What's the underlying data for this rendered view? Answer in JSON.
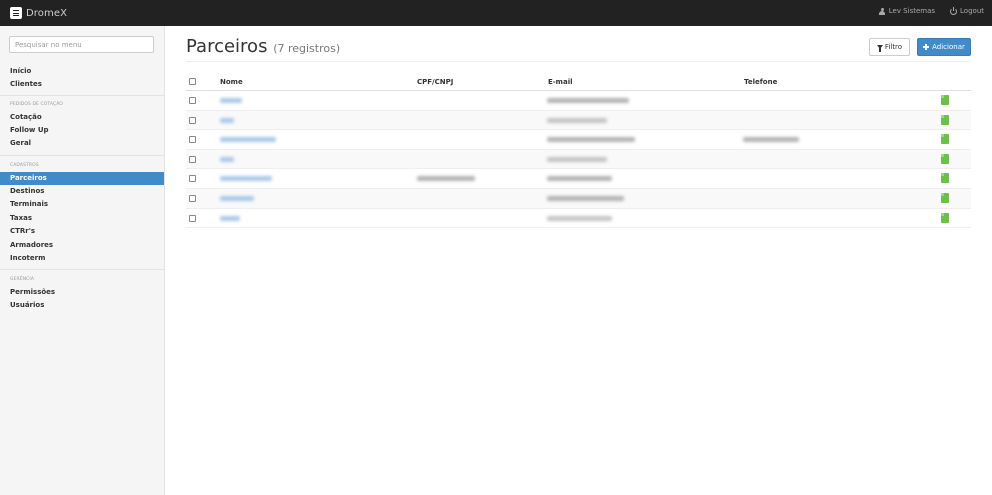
{
  "app": {
    "brand": "DromeX",
    "brand_icon": "list-icon"
  },
  "header": {
    "user_label": "Lev Sistemas",
    "user_icon": "user-icon",
    "logout_label": "Logout",
    "logout_icon": "power-icon"
  },
  "sidebar": {
    "search_placeholder": "Pesquisar no menu",
    "top_items": [
      "Início",
      "Clientes"
    ],
    "sections": [
      {
        "title": "PEDIDOS DE COTAÇÃO",
        "items": [
          "Cotação",
          "Follow Up",
          "Geral"
        ]
      },
      {
        "title": "CADASTROS",
        "items": [
          "Parceiros",
          "Destinos",
          "Terminais",
          "Taxas",
          "CTRr's",
          "Armadores",
          "Incoterm"
        ]
      },
      {
        "title": "GERÊNCIA",
        "items": [
          "Permissões",
          "Usuários"
        ]
      }
    ],
    "active_item": "Parceiros"
  },
  "page": {
    "title": "Parceiros",
    "count_label": "(7 registros)",
    "filter_label": "Filtro",
    "filter_icon": "funnel-icon",
    "add_label": "Adicionar",
    "add_icon": "plus-icon"
  },
  "table": {
    "columns": [
      "Nome",
      "CPF/CNPJ",
      "E-mail",
      "Telefone"
    ],
    "row_count": 7,
    "row_action_icon": "edit-icon",
    "note": "cell contents are blurred/redacted in the screenshot"
  },
  "colors": {
    "navbar": "#222222",
    "primary": "#428bca",
    "active_item": "#428bca",
    "edit_icon": "#6cc04a"
  }
}
